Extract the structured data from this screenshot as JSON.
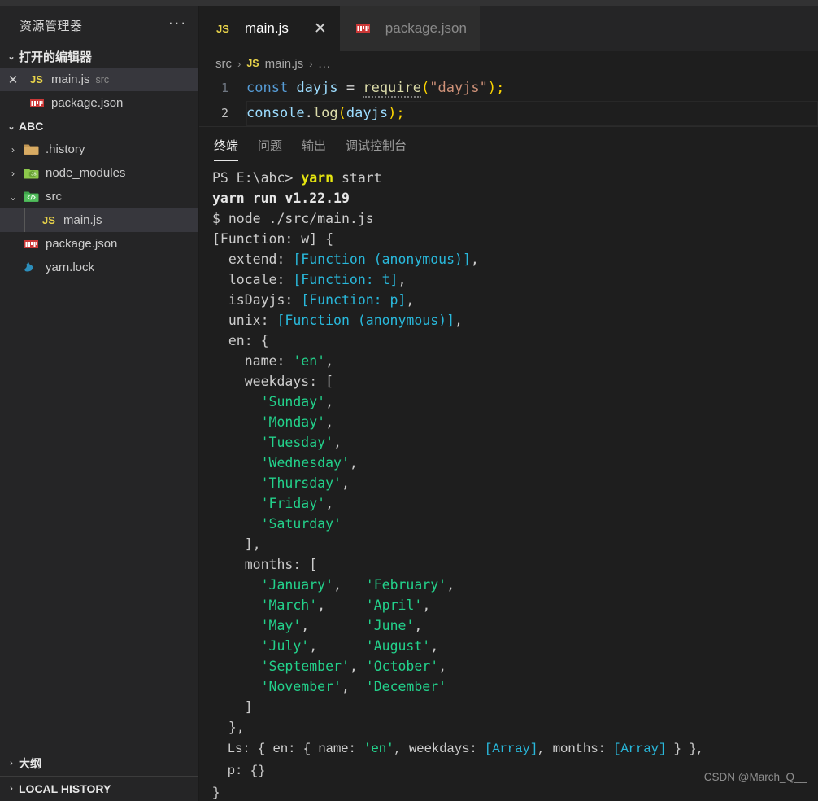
{
  "sidebar": {
    "title": "资源管理器",
    "more_label": "···",
    "open_editors": {
      "header": "打开的编辑器",
      "chevron": "⌄",
      "items": [
        {
          "icon": "js-file-icon",
          "label": "main.js",
          "sub": "src",
          "close": "✕",
          "selected": true
        },
        {
          "icon": "npm-file-icon",
          "label": "package.json",
          "sub": "",
          "close": "",
          "selected": false
        }
      ]
    },
    "workspace": {
      "header": "ABC",
      "chevron": "⌄",
      "items": [
        {
          "icon": "folder-history-icon",
          "label": ".history",
          "chevron": "›",
          "depth": 1,
          "selected": false
        },
        {
          "icon": "folder-node-modules-icon",
          "label": "node_modules",
          "chevron": "›",
          "depth": 1,
          "selected": false
        },
        {
          "icon": "folder-src-icon",
          "label": "src",
          "chevron": "⌄",
          "depth": 1,
          "selected": false
        },
        {
          "icon": "js-file-icon",
          "label": "main.js",
          "chevron": "",
          "depth": 2,
          "selected": true
        },
        {
          "icon": "npm-file-icon",
          "label": "package.json",
          "chevron": "",
          "depth": 1,
          "selected": false
        },
        {
          "icon": "yarn-lock-icon",
          "label": "yarn.lock",
          "chevron": "",
          "depth": 1,
          "selected": false
        }
      ]
    },
    "bottom_sections": [
      {
        "label": "大纲",
        "chevron": "›"
      },
      {
        "label": "LOCAL HISTORY",
        "chevron": "›"
      }
    ]
  },
  "editor": {
    "tabs": [
      {
        "icon": "js-file-icon",
        "label": "main.js",
        "close": "✕",
        "active": true
      },
      {
        "icon": "npm-file-icon",
        "label": "package.json",
        "close": "",
        "active": false
      }
    ],
    "breadcrumb": {
      "folder": "src",
      "sep1": "›",
      "file": "main.js",
      "sep2": "›",
      "dots": "..."
    },
    "lines": [
      {
        "no": "1"
      },
      {
        "no": "2"
      }
    ],
    "line1": {
      "const": "const",
      "space1": " ",
      "dayjs": "dayjs",
      "eq": " = ",
      "require": "require",
      "paren_open": "(",
      "str": "\"dayjs\"",
      "paren_close": ")",
      "semi": ";"
    },
    "line2": {
      "console": "console",
      "dot": ".",
      "log": "log",
      "paren_open": "(",
      "arg": "dayjs",
      "paren_close": ")",
      "semi": ";"
    }
  },
  "panel": {
    "tabs": [
      {
        "label": "终端",
        "active": true
      },
      {
        "label": "问题",
        "active": false
      },
      {
        "label": "输出",
        "active": false
      },
      {
        "label": "调试控制台",
        "active": false
      }
    ],
    "terminal": {
      "prompt": "PS E:\\abc> ",
      "prompt_cmd": "yarn",
      "prompt_args": " start",
      "line_yarn_run": "yarn run v1.22.19",
      "line_node": "$ node ./src/main.js",
      "l_open": "[Function: w] {",
      "k_extend": "  extend: ",
      "v_extend": "[Function (anonymous)]",
      "k_locale": "  locale: ",
      "v_locale": "[Function: t]",
      "k_isdayjs": "  isDayjs: ",
      "v_isdayjs": "[Function: p]",
      "k_unix": "  unix: ",
      "v_unix": "[Function (anonymous)]",
      "k_en": "  en: {",
      "k_name": "    name: ",
      "v_name": "'en'",
      "k_weekdays": "    weekdays: [",
      "weekdays": [
        "'Sunday'",
        "'Monday'",
        "'Tuesday'",
        "'Wednesday'",
        "'Thursday'",
        "'Friday'",
        "'Saturday'"
      ],
      "weekdays_close": "    ],",
      "k_months": "    months: [",
      "months_rows": [
        {
          "left": "'January'",
          "lcomma": ",",
          "right": "'February'",
          "rcomma": ","
        },
        {
          "left": "'March'",
          "lcomma": ",",
          "right": "'April'",
          "rcomma": ","
        },
        {
          "left": "'May'",
          "lcomma": ",",
          "right": "'June'",
          "rcomma": ","
        },
        {
          "left": "'July'",
          "lcomma": ",",
          "right": "'August'",
          "rcomma": ","
        },
        {
          "left": "'September'",
          "lcomma": ",",
          "right": "'October'",
          "rcomma": ","
        },
        {
          "left": "'November'",
          "lcomma": ",",
          "right": "'December'",
          "rcomma": ""
        }
      ],
      "months_close": "    ]",
      "en_close": "  },",
      "ls_prefix": "  Ls: { en: { name: ",
      "ls_name": "'en'",
      "ls_mid1": ", weekdays: ",
      "ls_arr1": "[Array]",
      "ls_mid2": ", months: ",
      "ls_arr2": "[Array]",
      "ls_suffix": " } },",
      "p_line": "  p: {}",
      "close_brace": "}"
    }
  },
  "watermark": "CSDN @March_Q__",
  "colors": {
    "accent_yellow": "#e5e510",
    "string_green": "#23d18b",
    "function_cyan": "#29b8db",
    "sidebar_bg": "#252526",
    "editor_bg": "#1e1e1e",
    "selection_bg": "#37373d"
  }
}
